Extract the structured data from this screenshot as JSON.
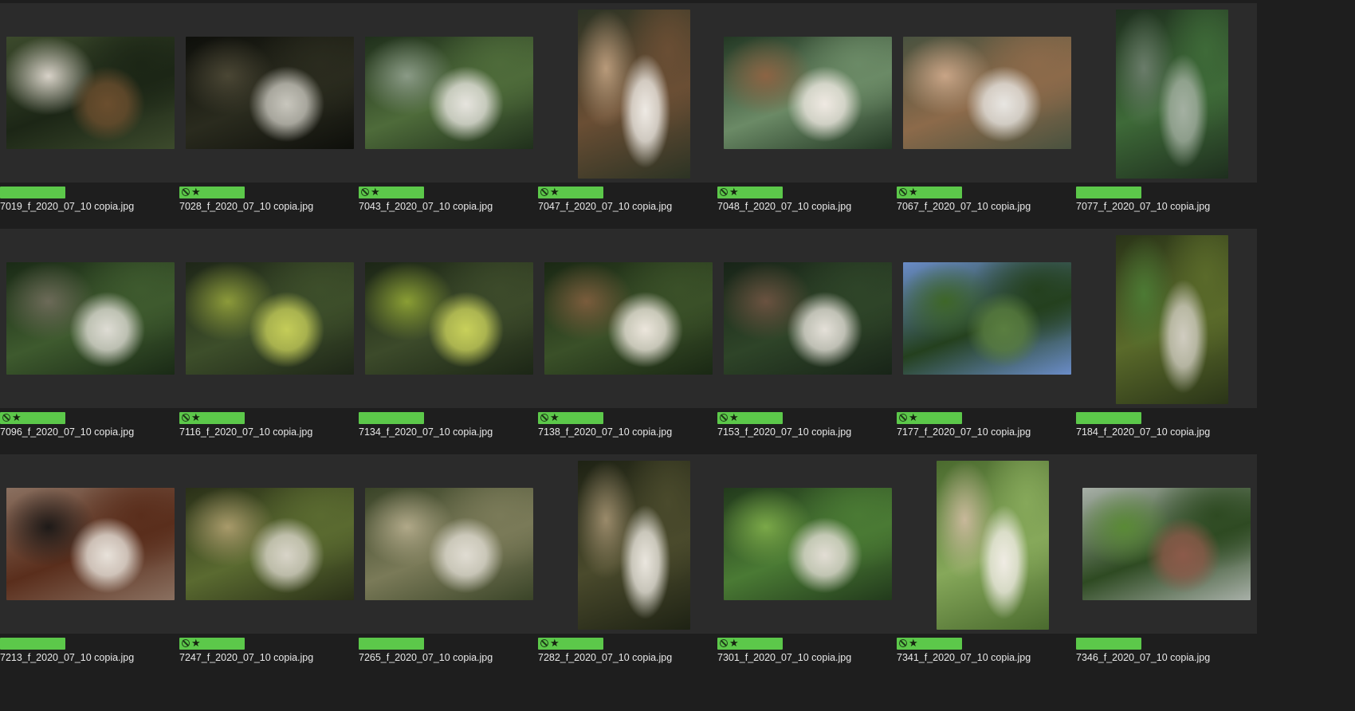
{
  "colors": {
    "background": "#1e1e1e",
    "card": "#2b2b2b",
    "label_green": "#5cc84a",
    "filename_text": "#e8e8e8"
  },
  "icons": {
    "reject": "reject-circle-icon",
    "star": "star-icon"
  },
  "star_glyph": "★",
  "photos": [
    {
      "filename": "7019_f_2020_07_10 copia.jpg",
      "orientation": "land",
      "rated": false,
      "palette": [
        "#3c4a2c",
        "#1c2616",
        "#d8d2c8",
        "#6b4e2e"
      ]
    },
    {
      "filename": "7028_f_2020_07_10 copia.jpg",
      "orientation": "land",
      "rated": true,
      "palette": [
        "#0e0f0b",
        "#2a2b1e",
        "#4a4634",
        "#c8c6bd"
      ]
    },
    {
      "filename": "7043_f_2020_07_10 copia.jpg",
      "orientation": "land",
      "rated": true,
      "palette": [
        "#20301c",
        "#4e6b3a",
        "#8a9a86",
        "#e6e4de"
      ]
    },
    {
      "filename": "7047_f_2020_07_10 copia.jpg",
      "orientation": "port",
      "rated": true,
      "palette": [
        "#2c3324",
        "#6a4e34",
        "#b89a7a",
        "#eeeae4"
      ]
    },
    {
      "filename": "7048_f_2020_07_10 copia.jpg",
      "orientation": "land",
      "rated": true,
      "palette": [
        "#233824",
        "#6b8a66",
        "#8c6444",
        "#efe9e2"
      ]
    },
    {
      "filename": "7067_f_2020_07_10 copia.jpg",
      "orientation": "land",
      "rated": true,
      "palette": [
        "#49523f",
        "#8c6a4a",
        "#c8a486",
        "#e8e6e2"
      ]
    },
    {
      "filename": "7077_f_2020_07_10 copia.jpg",
      "orientation": "port",
      "rated": false,
      "palette": [
        "#1e2e1e",
        "#3e6a38",
        "#6a7c6a",
        "#a4b0a2"
      ]
    },
    {
      "filename": "7096_f_2020_07_10 copia.jpg",
      "orientation": "land",
      "rated": true,
      "palette": [
        "#1a2a16",
        "#3e5a2e",
        "#6c6a58",
        "#dedcd4"
      ]
    },
    {
      "filename": "7116_f_2020_07_10 copia.jpg",
      "orientation": "land",
      "rated": true,
      "palette": [
        "#1e2618",
        "#3d4e2a",
        "#8c9a3a",
        "#c4cc58"
      ]
    },
    {
      "filename": "7134_f_2020_07_10 copia.jpg",
      "orientation": "land",
      "rated": false,
      "palette": [
        "#1c2616",
        "#3c4a2a",
        "#8a9e34",
        "#c8d05a"
      ]
    },
    {
      "filename": "7138_f_2020_07_10 copia.jpg",
      "orientation": "land",
      "rated": true,
      "palette": [
        "#1a2814",
        "#3a5028",
        "#7a5c3c",
        "#ece6dc"
      ]
    },
    {
      "filename": "7153_f_2020_07_10 copia.jpg",
      "orientation": "land",
      "rated": true,
      "palette": [
        "#182418",
        "#2e4428",
        "#6a5240",
        "#e4e0d8"
      ]
    },
    {
      "filename": "7177_f_2020_07_10 copia.jpg",
      "orientation": "land",
      "rated": true,
      "palette": [
        "#6a8cc8",
        "#24401e",
        "#3e6628",
        "#5a7e40"
      ]
    },
    {
      "filename": "7184_f_2020_07_10 copia.jpg",
      "orientation": "port",
      "rated": false,
      "palette": [
        "#2a3418",
        "#5a6a2a",
        "#4c7a34",
        "#d0ccc0"
      ]
    },
    {
      "filename": "7213_f_2020_07_10 copia.jpg",
      "orientation": "land",
      "rated": false,
      "palette": [
        "#8a7060",
        "#5a2e1c",
        "#1e1a18",
        "#e8e2da"
      ]
    },
    {
      "filename": "7247_f_2020_07_10 copia.jpg",
      "orientation": "land",
      "rated": true,
      "palette": [
        "#2a3018",
        "#5a6a30",
        "#a89a6a",
        "#d8d4c8"
      ]
    },
    {
      "filename": "7265_f_2020_07_10 copia.jpg",
      "orientation": "land",
      "rated": false,
      "palette": [
        "#3a4428",
        "#7a7a58",
        "#b0a888",
        "#e0dcd2"
      ]
    },
    {
      "filename": "7282_f_2020_07_10 copia.jpg",
      "orientation": "port",
      "rated": true,
      "palette": [
        "#1e2214",
        "#4a4a2c",
        "#9a8a6a",
        "#eae6de"
      ]
    },
    {
      "filename": "7301_f_2020_07_10 copia.jpg",
      "orientation": "land",
      "rated": true,
      "palette": [
        "#223a1c",
        "#4a7a34",
        "#7aa848",
        "#e2ddd4"
      ]
    },
    {
      "filename": "7341_f_2020_07_10 copia.jpg",
      "orientation": "port",
      "rated": true,
      "palette": [
        "#4a6a2e",
        "#86a85a",
        "#c8b89a",
        "#f0ece4"
      ]
    },
    {
      "filename": "7346_f_2020_07_10 copia.jpg",
      "orientation": "land",
      "rated": false,
      "palette": [
        "#a8b0a8",
        "#2e4a22",
        "#5a8a36",
        "#8c5a4a"
      ]
    }
  ]
}
